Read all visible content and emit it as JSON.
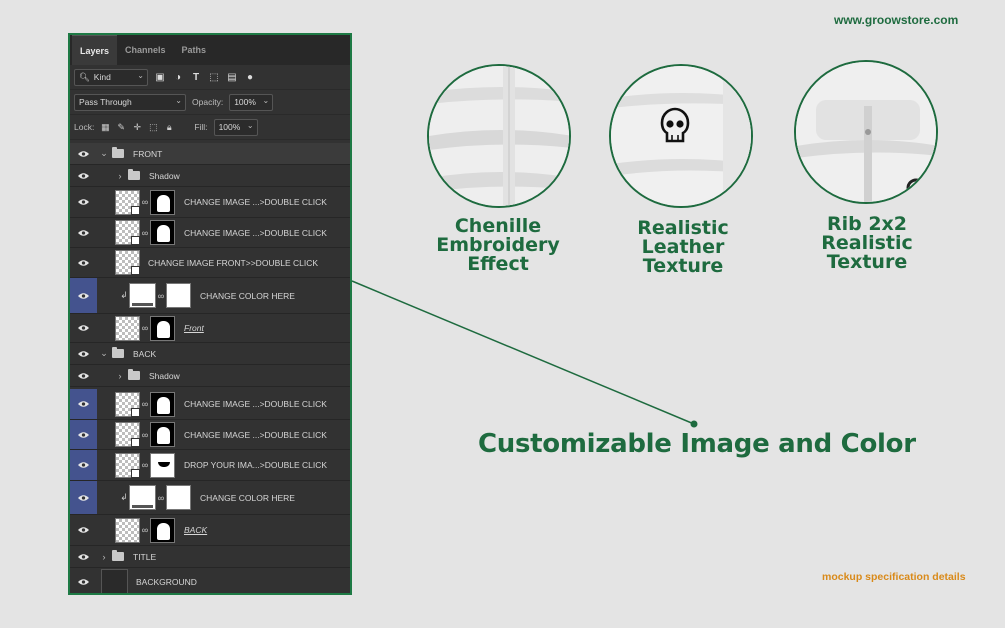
{
  "brand": {
    "url": "www.groowstore.com",
    "accent": "#1e6b3f",
    "footer_color": "#d98a1a"
  },
  "panel": {
    "tabs": [
      "Layers",
      "Channels",
      "Paths"
    ],
    "filter": {
      "kind_label": "Kind"
    },
    "blend": {
      "mode": "Pass Through",
      "opacity_label": "Opacity:",
      "opacity_value": "100%"
    },
    "lock": {
      "label": "Lock:",
      "fill_label": "Fill:",
      "fill_value": "100%"
    },
    "layers": [
      {
        "type": "group",
        "name": "FRONT",
        "expanded": true
      },
      {
        "type": "group",
        "name": "Shadow",
        "expanded": false
      },
      {
        "type": "smart",
        "name": "CHANGE IMAGE ...>DOUBLE CLICK",
        "selected": false
      },
      {
        "type": "smart",
        "name": "CHANGE IMAGE ...>DOUBLE CLICK",
        "selected": false
      },
      {
        "type": "smart",
        "name": "CHANGE IMAGE FRONT>>DOUBLE CLICK",
        "selected": false
      },
      {
        "type": "fill",
        "name": "CHANGE COLOR HERE",
        "selected": true
      },
      {
        "type": "base",
        "name": "Front",
        "selected": false
      },
      {
        "type": "group",
        "name": "BACK",
        "expanded": true
      },
      {
        "type": "group",
        "name": "Shadow",
        "expanded": false
      },
      {
        "type": "smart",
        "name": "CHANGE IMAGE ...>DOUBLE CLICK",
        "selected": true
      },
      {
        "type": "smart",
        "name": "CHANGE IMAGE ...>DOUBLE CLICK",
        "selected": true
      },
      {
        "type": "smart",
        "name": "DROP YOUR IMA...>DOUBLE CLICK",
        "selected": true
      },
      {
        "type": "fill",
        "name": "CHANGE COLOR HERE",
        "selected": true
      },
      {
        "type": "base",
        "name": "BACK",
        "selected": false
      },
      {
        "type": "group",
        "name": "TITLE",
        "expanded": false
      },
      {
        "type": "background",
        "name": "BACKGROUND",
        "selected": false
      }
    ]
  },
  "features": [
    {
      "lines": [
        "Chenille",
        "Embroidery",
        "Effect"
      ]
    },
    {
      "lines": [
        "Realistic",
        "Leather",
        "Texture"
      ]
    },
    {
      "lines": [
        "Rib 2x2",
        "Realistic",
        "Texture"
      ]
    }
  ],
  "headline": "Customizable Image and Color",
  "footer": "mockup specification details"
}
